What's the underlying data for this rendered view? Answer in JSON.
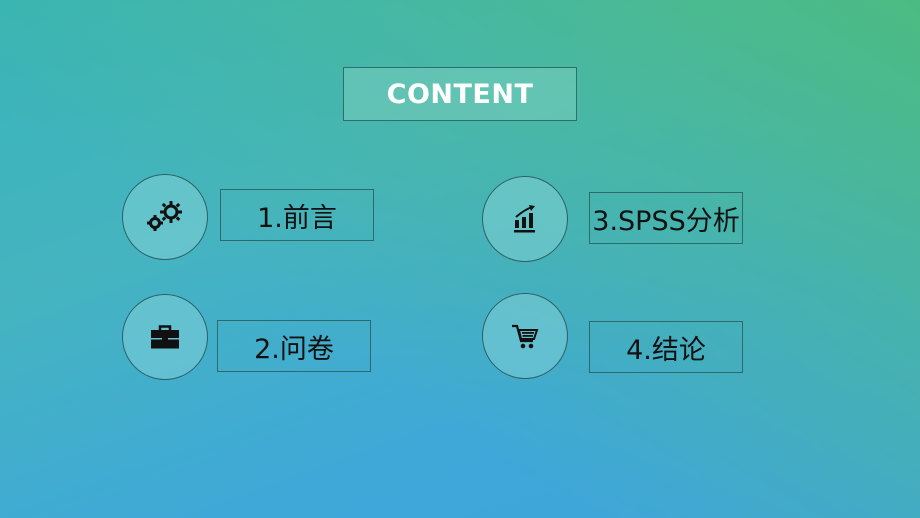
{
  "title": "CONTENT",
  "items": [
    {
      "label": "1.前言",
      "icon": "gears-icon"
    },
    {
      "label": "2.问卷",
      "icon": "briefcase-icon"
    },
    {
      "label": "3.SPSS分析",
      "icon": "growth-chart-icon"
    },
    {
      "label": "4.结论",
      "icon": "shopping-cart-icon"
    }
  ],
  "colors": {
    "bg_top_left": "#38b4b8",
    "bg_top_right": "#4cbb82",
    "bg_bottom_left": "#3fa4dc",
    "bg_bottom_right": "#3fb4bc",
    "title_text": "#ffffff",
    "label_text": "#111111"
  }
}
